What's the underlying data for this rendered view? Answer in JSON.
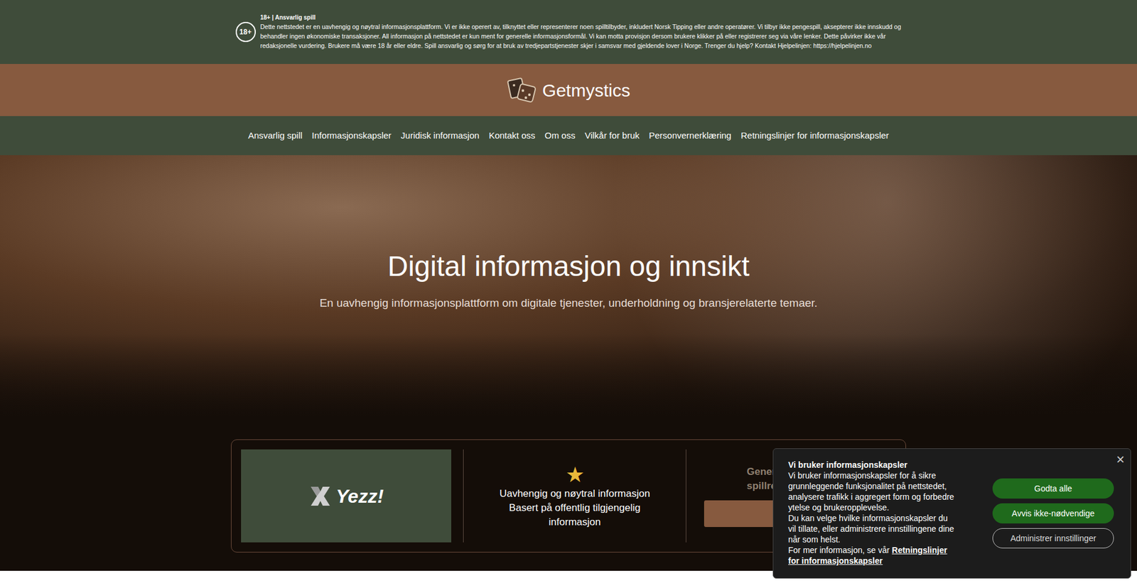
{
  "disclaimer": {
    "badge": "18+",
    "title": "18+ | Ansvarlig spill",
    "text": "Dette nettstedet er en uavhengig og nøytral informasjonsplattform. Vi er ikke operert av, tilknyttet eller representerer noen spilltilbyder, inkludert Norsk Tipping eller andre operatører. Vi tilbyr ikke pengespill, aksepterer ikke innskudd og behandler ingen økonomiske transaksjoner. All informasjon på nettstedet er kun ment for generelle informasjonsformål. Vi kan motta provisjon dersom brukere klikker på eller registrerer seg via våre lenker. Dette påvirker ikke vår redaksjonelle vurdering. Brukere må være 18 år eller eldre. Spill ansvarlig og sørg for at bruk av tredjepartstjenester skjer i samsvar med gjeldende lover i Norge. Trenger du hjelp? Kontakt Hjelpelinjen: https://hjelpelinjen.no"
  },
  "header": {
    "logo": "Getmystics"
  },
  "nav": [
    "Ansvarlig spill",
    "Informasjonskapsler",
    "Juridisk informasjon",
    "Kontakt oss",
    "Om oss",
    "Vilkår for bruk",
    "Personvernerklæring",
    "Retningslinjer for informasjonskapsler"
  ],
  "hero": {
    "title": "Digital informasjon og innsikt",
    "subtitle": "En uavhengig informasjonsplattform om digitale tjenester, underholdning og bransjerelaterte temaer."
  },
  "card": {
    "brand": "Yezz!",
    "star": "★",
    "lines": [
      "Uavhengig og nøytral informasjon",
      "Basert på offentlig tilgjengelig",
      "informasjon"
    ],
    "right_lines": [
      "Generell",
      "spillrel"
    ]
  },
  "cookie": {
    "title": "Vi bruker informasjonskapsler",
    "paragraphs": [
      "Vi bruker informasjonskapsler for å sikre grunnleggende funksjonalitet på nettstedet, analysere trafikk i aggregert form og forbedre ytelse og brukeropplevelse.",
      "Du kan velge hvilke informasjonskapsler du vil tillate, eller administrere innstillingene dine når som helst."
    ],
    "link_prefix": "For mer informasjon, se vår",
    "link": "Retningslinjer for informasjonskapsler",
    "close": "×",
    "buttons": [
      {
        "label": "Godta alle",
        "kind": "primary"
      },
      {
        "label": "Avvis ikke-nødvendige",
        "kind": "primary"
      },
      {
        "label": "Administrer innstillinger",
        "kind": "outline"
      }
    ]
  }
}
